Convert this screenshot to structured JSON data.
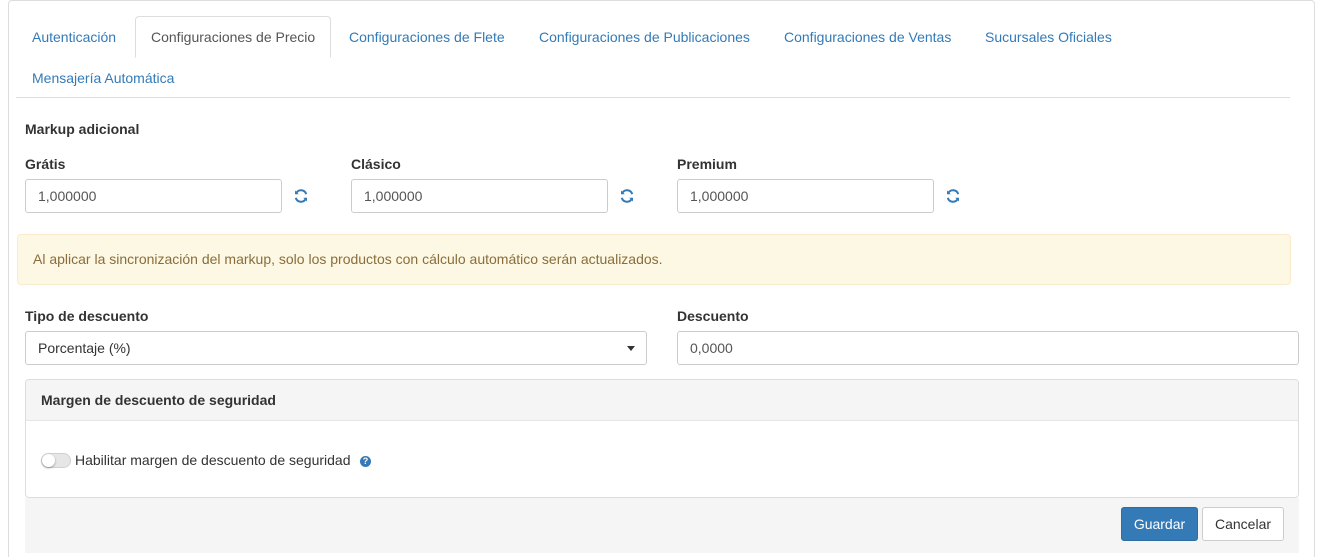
{
  "tabs": [
    {
      "label": "Autenticación"
    },
    {
      "label": "Configuraciones de Precio",
      "active": true
    },
    {
      "label": "Configuraciones de Flete"
    },
    {
      "label": "Configuraciones de Publicaciones"
    },
    {
      "label": "Configuraciones de Ventas"
    },
    {
      "label": "Sucursales Oficiales"
    },
    {
      "label": "Mensajería Automática"
    }
  ],
  "markup": {
    "title": "Markup adicional",
    "gratis": {
      "label": "Grátis",
      "value": "1,000000"
    },
    "clasico": {
      "label": "Clásico",
      "value": "1,000000"
    },
    "premium": {
      "label": "Premium",
      "value": "1,000000"
    },
    "sync_icon": "sync-icon"
  },
  "alert": {
    "text": "Al aplicar la sincronización del markup, solo los productos con cálculo automático serán actualizados."
  },
  "discount": {
    "type_label": "Tipo de descuento",
    "type_value": "Porcentaje (%)",
    "value_label": "Descuento",
    "value": "0,0000"
  },
  "security_margin": {
    "title": "Margen de descuento de seguridad",
    "toggle_label": "Habilitar margen de descuento de seguridad",
    "toggle_on": false,
    "help_icon": "question-circle-icon"
  },
  "actions": {
    "save": "Guardar",
    "cancel": "Cancelar"
  },
  "colors": {
    "link": "#337ab7",
    "primary": "#337ab7",
    "alert_bg": "#fcf8e3",
    "alert_text": "#8a6d3b"
  }
}
